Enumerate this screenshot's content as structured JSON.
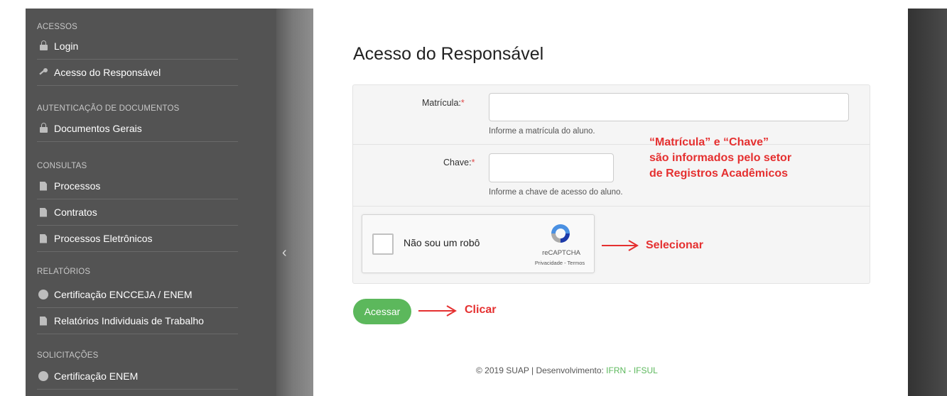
{
  "sidebar": {
    "sections": [
      {
        "title": "ACESSOS",
        "items": [
          {
            "label": "Login",
            "icon": "lock-icon"
          },
          {
            "label": "Acesso do Responsável",
            "icon": "key-icon"
          }
        ]
      },
      {
        "title": "AUTENTICAÇÃO DE DOCUMENTOS",
        "items": [
          {
            "label": "Documentos Gerais",
            "icon": "lock-icon"
          }
        ]
      },
      {
        "title": "CONSULTAS",
        "items": [
          {
            "label": "Processos",
            "icon": "document-icon"
          },
          {
            "label": "Contratos",
            "icon": "document-icon"
          },
          {
            "label": "Processos Eletrônicos",
            "icon": "document-icon"
          }
        ]
      },
      {
        "title": "RELATÓRIOS",
        "items": [
          {
            "label": "Certificação ENCCEJA / ENEM",
            "icon": "gear-icon"
          },
          {
            "label": "Relatórios Individuais de Trabalho",
            "icon": "document-icon"
          }
        ]
      },
      {
        "title": "SOLICITAÇÕES",
        "items": [
          {
            "label": "Certificação ENEM",
            "icon": "gear-icon"
          }
        ]
      }
    ],
    "collapse_icon": "chevron-left-icon"
  },
  "main": {
    "title": "Acesso do Responsável",
    "fields": {
      "matricula": {
        "label": "Matrícula:",
        "required": "*",
        "value": "",
        "help": "Informe a matrícula do aluno."
      },
      "chave": {
        "label": "Chave:",
        "required": "*",
        "value": "",
        "help": "Informe a chave de acesso do aluno."
      }
    },
    "captcha": {
      "text": "Não sou um robô",
      "brand": "reCAPTCHA",
      "terms": "Privacidade - Termos"
    },
    "submit_label": "Acessar"
  },
  "annotations": {
    "note_line1": "“Matrícula” e “Chave”",
    "note_line2": "são informados pelo setor",
    "note_line3": "de Registros Acadêmicos",
    "select": "Selecionar",
    "click": "Clicar",
    "color": "#e53030"
  },
  "footer": {
    "text": "© 2019 SUAP | Desenvolvimento: ",
    "link": "IFRN - IFSUL"
  },
  "colors": {
    "sidebar_bg": "#535353",
    "accent_green": "#5cb85c",
    "required_red": "#e04b4b"
  }
}
